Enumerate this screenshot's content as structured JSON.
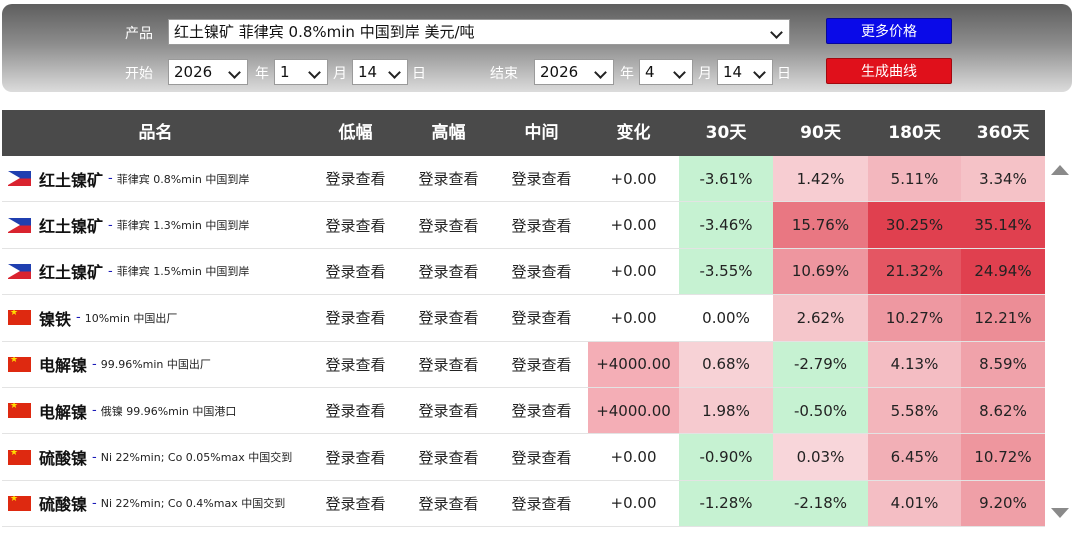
{
  "filters": {
    "product_label": "产品",
    "product_value": "红土镍矿 菲律宾 0.8%min 中国到岸 美元/吨",
    "more_prices_label": "更多价格",
    "start_label": "开始",
    "end_label": "结束",
    "start": {
      "year": "2026",
      "month": "1",
      "day": "14"
    },
    "end": {
      "year": "2026",
      "month": "4",
      "day": "14"
    },
    "year_unit": "年",
    "month_unit": "月",
    "day_unit": "日",
    "generate_label": "生成曲线"
  },
  "table": {
    "headers": [
      "品名",
      "低幅",
      "高幅",
      "中间",
      "变化",
      "30天",
      "90天",
      "180天",
      "360天"
    ],
    "rows": [
      {
        "flag": "philippines-flag",
        "name": "红土镍矿",
        "desc": "菲律宾 0.8%min 中国到岸",
        "low": "登录查看",
        "high": "登录查看",
        "mid": "登录查看",
        "change": "+0.00",
        "d30": "-3.61%",
        "d90": "1.42%",
        "d180": "5.11%",
        "d360": "3.34%"
      },
      {
        "flag": "philippines-flag",
        "name": "红土镍矿",
        "desc": "菲律宾 1.3%min 中国到岸",
        "low": "登录查看",
        "high": "登录查看",
        "mid": "登录查看",
        "change": "+0.00",
        "d30": "-3.46%",
        "d90": "15.76%",
        "d180": "30.25%",
        "d360": "35.14%"
      },
      {
        "flag": "philippines-flag",
        "name": "红土镍矿",
        "desc": "菲律宾 1.5%min 中国到岸",
        "low": "登录查看",
        "high": "登录查看",
        "mid": "登录查看",
        "change": "+0.00",
        "d30": "-3.55%",
        "d90": "10.69%",
        "d180": "21.32%",
        "d360": "24.94%"
      },
      {
        "flag": "china-flag",
        "name": "镍铁",
        "desc": "10%min 中国出厂",
        "low": "登录查看",
        "high": "登录查看",
        "mid": "登录查看",
        "change": "+0.00",
        "d30": "0.00%",
        "d90": "2.62%",
        "d180": "10.27%",
        "d360": "12.21%"
      },
      {
        "flag": "china-flag",
        "name": "电解镍",
        "desc": "99.96%min 中国出厂",
        "low": "登录查看",
        "high": "登录查看",
        "mid": "登录查看",
        "change": "+4000.00",
        "d30": "0.68%",
        "d90": "-2.79%",
        "d180": "4.13%",
        "d360": "8.59%"
      },
      {
        "flag": "china-flag",
        "name": "电解镍",
        "desc": "俄镍 99.96%min 中国港口",
        "low": "登录查看",
        "high": "登录查看",
        "mid": "登录查看",
        "change": "+4000.00",
        "d30": "1.98%",
        "d90": "-0.50%",
        "d180": "5.58%",
        "d360": "8.62%"
      },
      {
        "flag": "china-flag",
        "name": "硫酸镍",
        "desc": "Ni 22%min; Co 0.05%max 中国交到",
        "low": "登录查看",
        "high": "登录查看",
        "mid": "登录查看",
        "change": "+0.00",
        "d30": "-0.90%",
        "d90": "0.03%",
        "d180": "6.45%",
        "d360": "10.72%"
      },
      {
        "flag": "china-flag",
        "name": "硫酸镍",
        "desc": "Ni 22%min; Co 0.4%max 中国交到",
        "low": "登录查看",
        "high": "登录查看",
        "mid": "登录查看",
        "change": "+0.00",
        "d30": "-1.28%",
        "d90": "-2.18%",
        "d180": "4.01%",
        "d360": "9.20%"
      }
    ]
  },
  "colors": {
    "header_bg": "#4a4a4a",
    "button_blue": "#0a0ae8",
    "button_red": "#e0101b",
    "cell_negative": "#c6f2d2",
    "cell_positive_light": "#f6c9cf",
    "cell_positive_strong": "#e0404f"
  }
}
